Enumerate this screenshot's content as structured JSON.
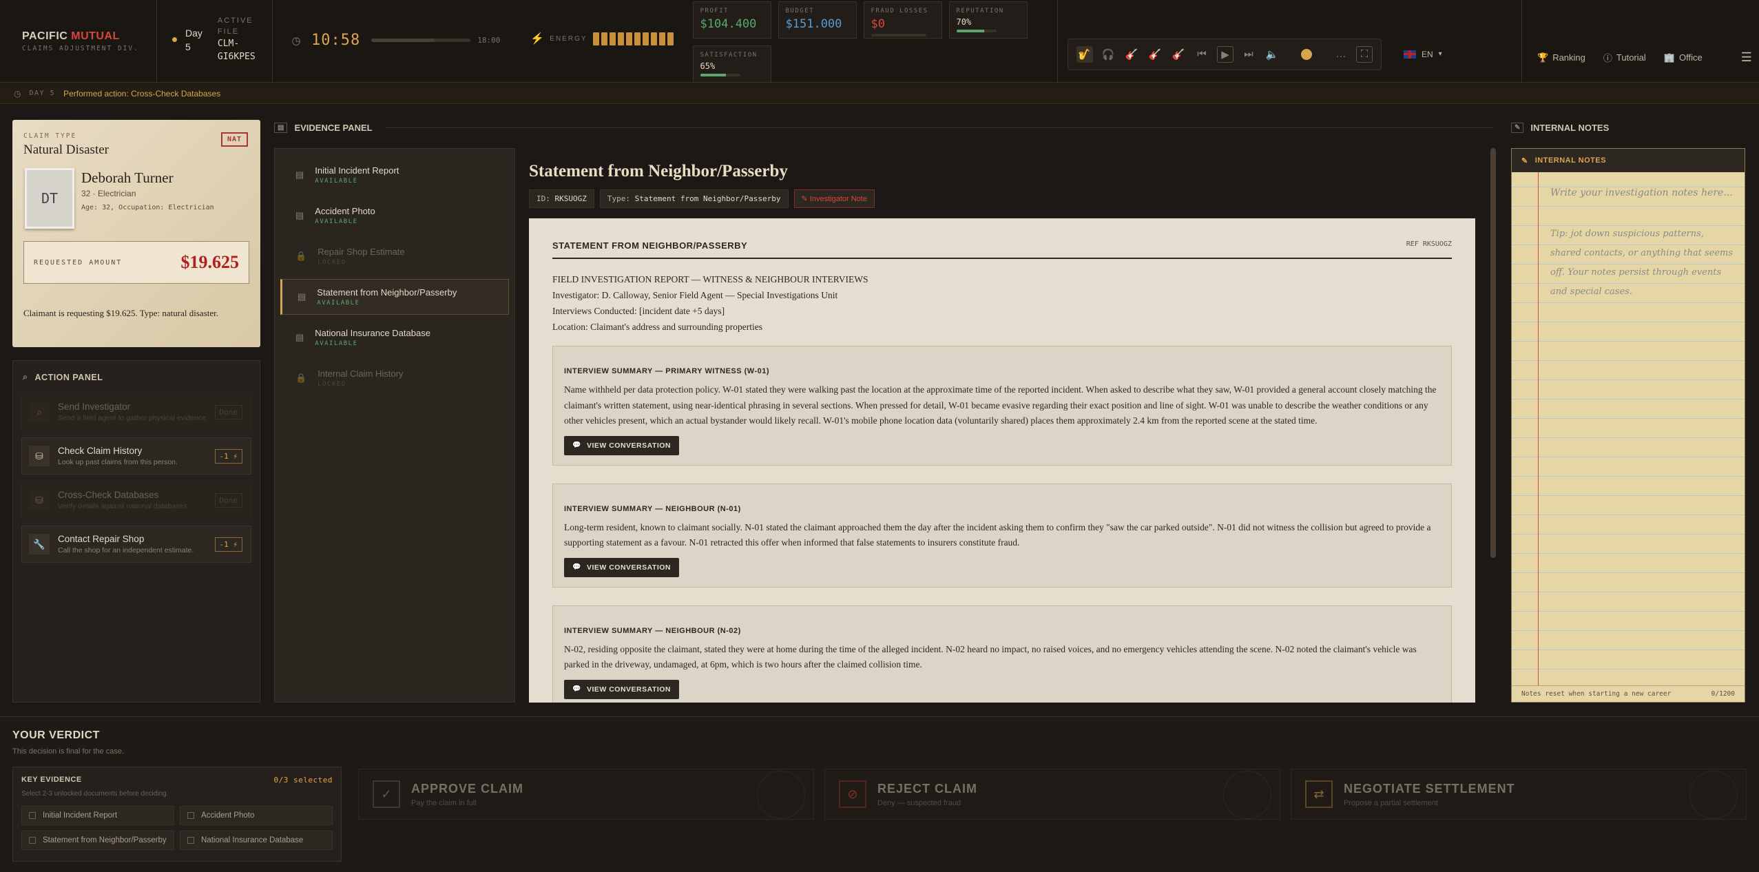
{
  "brand": {
    "name_a": "PACIFIC ",
    "name_b": "MUTUAL",
    "sub": "CLAIMS ADJUSTMENT DIV."
  },
  "day": {
    "label": "Day",
    "value": "5"
  },
  "file": {
    "label1": "ACTIVE",
    "label2": "FILE",
    "id1": "CLM-",
    "id2": "GI6KPES"
  },
  "clock": {
    "time": "10:58",
    "end": "18:00",
    "progress": 0.64
  },
  "energy": {
    "label": "ENERGY",
    "level": 10,
    "max": 10
  },
  "stats": [
    {
      "key": "PROFIT",
      "value": "$104.400",
      "color": "#5aa86e"
    },
    {
      "key": "BUDGET",
      "value": "$151.000",
      "color": "#5b9bd5"
    },
    {
      "key": "FRAUD LOSSES",
      "value": "$0",
      "color": "#d9463b"
    },
    {
      "key": "REPUTATION",
      "value": "70%",
      "color": "#e2d8c6",
      "bar": 0.7
    },
    {
      "key": "SATISFACTION",
      "value": "65%",
      "color": "#e2d8c6",
      "bar": 0.65
    }
  ],
  "lang": {
    "code": "EN"
  },
  "nav": {
    "ranking": "Ranking",
    "tutorial": "Tutorial",
    "office": "Office"
  },
  "activity": {
    "day": "DAY 5",
    "message": "Performed action: Cross-Check Databases"
  },
  "claim": {
    "type_label": "CLAIM TYPE",
    "type": "Natural Disaster",
    "badge": "NAT",
    "initials": "DT",
    "name": "Deborah Turner",
    "job": "32 · Electrician",
    "meta": "Age: 32, Occupation: Electrician",
    "req_label": "REQUESTED AMOUNT",
    "req_value": "$19.625",
    "description": "Claimant is requesting $19.625. Type: natural disaster."
  },
  "action_panel": {
    "title": "ACTION PANEL",
    "actions": [
      {
        "title": "Send Investigator",
        "desc": "Send a field agent to gather physical evidence.",
        "cost": "Done",
        "icon": "search-icon"
      },
      {
        "title": "Check Claim History",
        "desc": "Look up past claims from this person.",
        "cost": "-1 ⚡",
        "icon": "database-icon"
      },
      {
        "title": "Cross-Check Databases",
        "desc": "Verify details against national databases.",
        "cost": "Done",
        "icon": "database-icon"
      },
      {
        "title": "Contact Repair Shop",
        "desc": "Call the shop for an independent estimate.",
        "cost": "-1 ⚡",
        "icon": "wrench-icon"
      }
    ]
  },
  "evidence": {
    "title": "EVIDENCE PANEL",
    "items": [
      {
        "title": "Initial Incident Report",
        "status": "AVAILABLE"
      },
      {
        "title": "Accident Photo",
        "status": "AVAILABLE"
      },
      {
        "title": "Repair Shop Estimate",
        "status": "LOCKED"
      },
      {
        "title": "Statement from Neighbor/Passerby",
        "status": "AVAILABLE"
      },
      {
        "title": "National Insurance Database",
        "status": "AVAILABLE"
      },
      {
        "title": "Internal Claim History",
        "status": "LOCKED"
      }
    ]
  },
  "document": {
    "title": "Statement from Neighbor/Passerby",
    "id_label": "ID:",
    "id": "RKSUOGZ",
    "type_label": "Type:",
    "type": "Statement from Neighbor/Passerby",
    "note_tag": "Investigator Note",
    "paper_title": "STATEMENT FROM NEIGHBOR/PASSERBY",
    "ref": "REF RKSUOGZ",
    "intro": [
      "FIELD INVESTIGATION REPORT — WITNESS & NEIGHBOUR INTERVIEWS",
      "Investigator: D. Calloway, Senior Field Agent — Special Investigations Unit",
      "Interviews Conducted: [incident date +5 days]",
      "Location: Claimant's address and surrounding properties"
    ],
    "button_label": "VIEW CONVERSATION",
    "interviews": [
      {
        "heading": "INTERVIEW SUMMARY — PRIMARY WITNESS (W-01)",
        "text": "Name withheld per data protection policy. W-01 stated they were walking past the location at the approximate time of the reported incident. When asked to describe what they saw, W-01 provided a general account closely matching the claimant's written statement, using near-identical phrasing in several sections. When pressed for detail, W-01 became evasive regarding their exact position and line of sight. W-01 was unable to describe the weather conditions or any other vehicles present, which an actual bystander would likely recall. W-01's mobile phone location data (voluntarily shared) places them approximately 2.4 km from the reported scene at the stated time."
      },
      {
        "heading": "INTERVIEW SUMMARY — NEIGHBOUR (N-01)",
        "text": "Long-term resident, known to claimant socially. N-01 stated the claimant approached them the day after the incident asking them to confirm they \"saw the car parked outside\". N-01 did not witness the collision but agreed to provide a supporting statement as a favour. N-01 retracted this offer when informed that false statements to insurers constitute fraud."
      },
      {
        "heading": "INTERVIEW SUMMARY — NEIGHBOUR (N-02)",
        "text": "N-02, residing opposite the claimant, stated they were at home during the time of the alleged incident. N-02 heard no impact, no raised voices, and no emergency vehicles attending the scene. N-02 noted the claimant's vehicle was parked in the driveway, undamaged, at 6pm, which is two hours after the claimed collision time."
      }
    ]
  },
  "notes": {
    "header": "INTERNAL NOTES",
    "title": "INTERNAL NOTES",
    "placeholder": "Write your investigation notes here...",
    "tip": "Tip: jot down suspicious patterns, shared contacts, or anything that seems off. Your notes persist through events and special cases.",
    "footer": "Notes reset when starting a new career",
    "count": "0/1200"
  },
  "verdict": {
    "title": "YOUR VERDICT",
    "subtitle": "This decision is final for the case.",
    "key_title": "KEY EVIDENCE",
    "key_count": "0/3 selected",
    "key_desc": "Select 2-3 unlocked documents before deciding.",
    "key_items": [
      "Initial Incident Report",
      "Accident Photo",
      "Statement from Neighbor/Passerby",
      "National Insurance Database"
    ],
    "approve": {
      "title": "APPROVE CLAIM",
      "desc": "Pay the claim in full"
    },
    "reject": {
      "title": "REJECT CLAIM",
      "desc": "Deny — suspected fraud"
    },
    "negotiate": {
      "title": "NEGOTIATE SETTLEMENT",
      "desc": "Propose a partial settlement"
    }
  }
}
